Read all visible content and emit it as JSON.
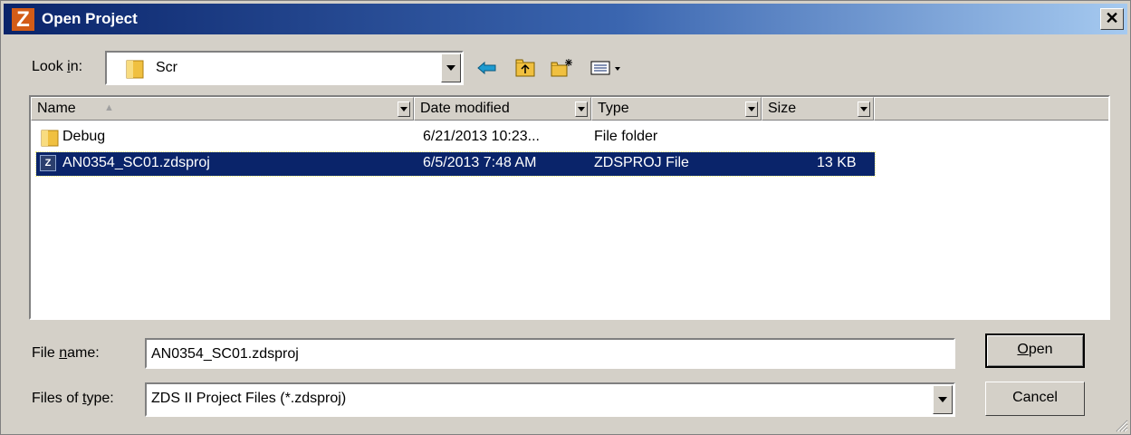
{
  "window": {
    "title": "Open Project",
    "app_icon_letter": "Z"
  },
  "look_in": {
    "label_pre": "Look ",
    "label_key": "i",
    "label_post": "n:",
    "value": "Scr"
  },
  "toolbar": {
    "back": "back-arrow-icon",
    "up": "up-folder-icon",
    "new_folder": "new-folder-icon",
    "view_menu": "view-menu-icon"
  },
  "columns": [
    "Name",
    "Date modified",
    "Type",
    "Size"
  ],
  "files": [
    {
      "name": "Debug",
      "date": "6/21/2013 10:23...",
      "type": "File folder",
      "size": "",
      "icon": "folder-icon"
    },
    {
      "name": "AN0354_SC01.zdsproj",
      "date": "6/5/2013 7:48 AM",
      "type": "ZDSPROJ File",
      "size": "13 KB",
      "icon": "zds-project-icon"
    }
  ],
  "file_name": {
    "label_pre": "File ",
    "label_key": "n",
    "label_post": "ame:",
    "value": "AN0354_SC01.zdsproj"
  },
  "file_type": {
    "label_pre": "Files of ",
    "label_key": "t",
    "label_post": "ype:",
    "value": "ZDS II Project Files (*.zdsproj)"
  },
  "buttons": {
    "open_key": "O",
    "open_rest": "pen",
    "cancel": "Cancel"
  },
  "colors": {
    "title_start": "#0a246a",
    "title_end": "#a6caf0",
    "selection": "#0a246a",
    "face": "#d4d0c8"
  }
}
